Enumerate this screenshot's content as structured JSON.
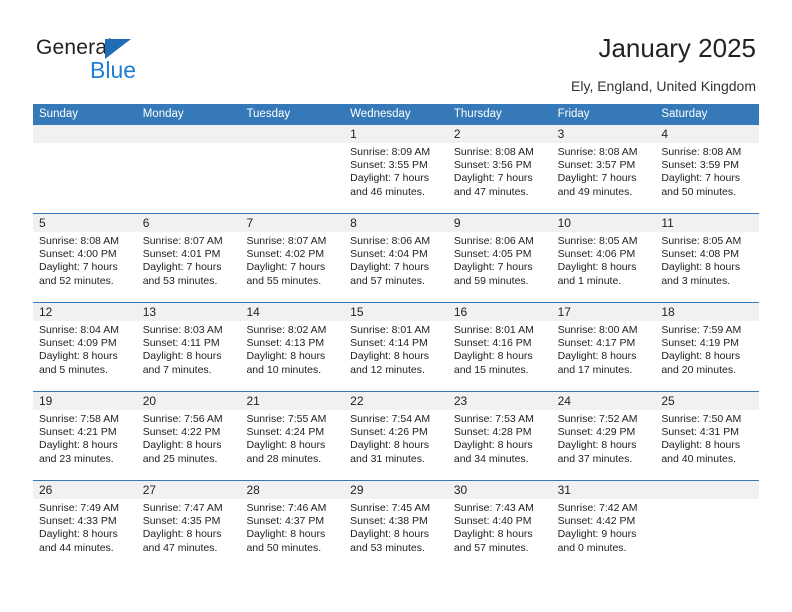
{
  "brand": {
    "name_primary": "General",
    "name_secondary": "Blue",
    "accent_color": "#1f7fd4",
    "triangle_color": "#1f6db4"
  },
  "header": {
    "title": "January 2025",
    "subtitle": "Ely, England, United Kingdom"
  },
  "calendar": {
    "header_bg": "#3579b8",
    "daynum_bg": "#f1f1f1",
    "weekday_labels": [
      "Sunday",
      "Monday",
      "Tuesday",
      "Wednesday",
      "Thursday",
      "Friday",
      "Saturday"
    ],
    "weeks": [
      {
        "days": [
          {
            "num": "",
            "sunrise": "",
            "sunset": "",
            "daylight_line1": "",
            "daylight_line2": "",
            "empty": true
          },
          {
            "num": "",
            "sunrise": "",
            "sunset": "",
            "daylight_line1": "",
            "daylight_line2": "",
            "empty": true
          },
          {
            "num": "",
            "sunrise": "",
            "sunset": "",
            "daylight_line1": "",
            "daylight_line2": "",
            "empty": true
          },
          {
            "num": "1",
            "sunrise": "Sunrise: 8:09 AM",
            "sunset": "Sunset: 3:55 PM",
            "daylight_line1": "Daylight: 7 hours",
            "daylight_line2": "and 46 minutes.",
            "empty": false
          },
          {
            "num": "2",
            "sunrise": "Sunrise: 8:08 AM",
            "sunset": "Sunset: 3:56 PM",
            "daylight_line1": "Daylight: 7 hours",
            "daylight_line2": "and 47 minutes.",
            "empty": false
          },
          {
            "num": "3",
            "sunrise": "Sunrise: 8:08 AM",
            "sunset": "Sunset: 3:57 PM",
            "daylight_line1": "Daylight: 7 hours",
            "daylight_line2": "and 49 minutes.",
            "empty": false
          },
          {
            "num": "4",
            "sunrise": "Sunrise: 8:08 AM",
            "sunset": "Sunset: 3:59 PM",
            "daylight_line1": "Daylight: 7 hours",
            "daylight_line2": "and 50 minutes.",
            "empty": false
          }
        ]
      },
      {
        "days": [
          {
            "num": "5",
            "sunrise": "Sunrise: 8:08 AM",
            "sunset": "Sunset: 4:00 PM",
            "daylight_line1": "Daylight: 7 hours",
            "daylight_line2": "and 52 minutes.",
            "empty": false
          },
          {
            "num": "6",
            "sunrise": "Sunrise: 8:07 AM",
            "sunset": "Sunset: 4:01 PM",
            "daylight_line1": "Daylight: 7 hours",
            "daylight_line2": "and 53 minutes.",
            "empty": false
          },
          {
            "num": "7",
            "sunrise": "Sunrise: 8:07 AM",
            "sunset": "Sunset: 4:02 PM",
            "daylight_line1": "Daylight: 7 hours",
            "daylight_line2": "and 55 minutes.",
            "empty": false
          },
          {
            "num": "8",
            "sunrise": "Sunrise: 8:06 AM",
            "sunset": "Sunset: 4:04 PM",
            "daylight_line1": "Daylight: 7 hours",
            "daylight_line2": "and 57 minutes.",
            "empty": false
          },
          {
            "num": "9",
            "sunrise": "Sunrise: 8:06 AM",
            "sunset": "Sunset: 4:05 PM",
            "daylight_line1": "Daylight: 7 hours",
            "daylight_line2": "and 59 minutes.",
            "empty": false
          },
          {
            "num": "10",
            "sunrise": "Sunrise: 8:05 AM",
            "sunset": "Sunset: 4:06 PM",
            "daylight_line1": "Daylight: 8 hours",
            "daylight_line2": "and 1 minute.",
            "empty": false
          },
          {
            "num": "11",
            "sunrise": "Sunrise: 8:05 AM",
            "sunset": "Sunset: 4:08 PM",
            "daylight_line1": "Daylight: 8 hours",
            "daylight_line2": "and 3 minutes.",
            "empty": false
          }
        ]
      },
      {
        "days": [
          {
            "num": "12",
            "sunrise": "Sunrise: 8:04 AM",
            "sunset": "Sunset: 4:09 PM",
            "daylight_line1": "Daylight: 8 hours",
            "daylight_line2": "and 5 minutes.",
            "empty": false
          },
          {
            "num": "13",
            "sunrise": "Sunrise: 8:03 AM",
            "sunset": "Sunset: 4:11 PM",
            "daylight_line1": "Daylight: 8 hours",
            "daylight_line2": "and 7 minutes.",
            "empty": false
          },
          {
            "num": "14",
            "sunrise": "Sunrise: 8:02 AM",
            "sunset": "Sunset: 4:13 PM",
            "daylight_line1": "Daylight: 8 hours",
            "daylight_line2": "and 10 minutes.",
            "empty": false
          },
          {
            "num": "15",
            "sunrise": "Sunrise: 8:01 AM",
            "sunset": "Sunset: 4:14 PM",
            "daylight_line1": "Daylight: 8 hours",
            "daylight_line2": "and 12 minutes.",
            "empty": false
          },
          {
            "num": "16",
            "sunrise": "Sunrise: 8:01 AM",
            "sunset": "Sunset: 4:16 PM",
            "daylight_line1": "Daylight: 8 hours",
            "daylight_line2": "and 15 minutes.",
            "empty": false
          },
          {
            "num": "17",
            "sunrise": "Sunrise: 8:00 AM",
            "sunset": "Sunset: 4:17 PM",
            "daylight_line1": "Daylight: 8 hours",
            "daylight_line2": "and 17 minutes.",
            "empty": false
          },
          {
            "num": "18",
            "sunrise": "Sunrise: 7:59 AM",
            "sunset": "Sunset: 4:19 PM",
            "daylight_line1": "Daylight: 8 hours",
            "daylight_line2": "and 20 minutes.",
            "empty": false
          }
        ]
      },
      {
        "days": [
          {
            "num": "19",
            "sunrise": "Sunrise: 7:58 AM",
            "sunset": "Sunset: 4:21 PM",
            "daylight_line1": "Daylight: 8 hours",
            "daylight_line2": "and 23 minutes.",
            "empty": false
          },
          {
            "num": "20",
            "sunrise": "Sunrise: 7:56 AM",
            "sunset": "Sunset: 4:22 PM",
            "daylight_line1": "Daylight: 8 hours",
            "daylight_line2": "and 25 minutes.",
            "empty": false
          },
          {
            "num": "21",
            "sunrise": "Sunrise: 7:55 AM",
            "sunset": "Sunset: 4:24 PM",
            "daylight_line1": "Daylight: 8 hours",
            "daylight_line2": "and 28 minutes.",
            "empty": false
          },
          {
            "num": "22",
            "sunrise": "Sunrise: 7:54 AM",
            "sunset": "Sunset: 4:26 PM",
            "daylight_line1": "Daylight: 8 hours",
            "daylight_line2": "and 31 minutes.",
            "empty": false
          },
          {
            "num": "23",
            "sunrise": "Sunrise: 7:53 AM",
            "sunset": "Sunset: 4:28 PM",
            "daylight_line1": "Daylight: 8 hours",
            "daylight_line2": "and 34 minutes.",
            "empty": false
          },
          {
            "num": "24",
            "sunrise": "Sunrise: 7:52 AM",
            "sunset": "Sunset: 4:29 PM",
            "daylight_line1": "Daylight: 8 hours",
            "daylight_line2": "and 37 minutes.",
            "empty": false
          },
          {
            "num": "25",
            "sunrise": "Sunrise: 7:50 AM",
            "sunset": "Sunset: 4:31 PM",
            "daylight_line1": "Daylight: 8 hours",
            "daylight_line2": "and 40 minutes.",
            "empty": false
          }
        ]
      },
      {
        "days": [
          {
            "num": "26",
            "sunrise": "Sunrise: 7:49 AM",
            "sunset": "Sunset: 4:33 PM",
            "daylight_line1": "Daylight: 8 hours",
            "daylight_line2": "and 44 minutes.",
            "empty": false
          },
          {
            "num": "27",
            "sunrise": "Sunrise: 7:47 AM",
            "sunset": "Sunset: 4:35 PM",
            "daylight_line1": "Daylight: 8 hours",
            "daylight_line2": "and 47 minutes.",
            "empty": false
          },
          {
            "num": "28",
            "sunrise": "Sunrise: 7:46 AM",
            "sunset": "Sunset: 4:37 PM",
            "daylight_line1": "Daylight: 8 hours",
            "daylight_line2": "and 50 minutes.",
            "empty": false
          },
          {
            "num": "29",
            "sunrise": "Sunrise: 7:45 AM",
            "sunset": "Sunset: 4:38 PM",
            "daylight_line1": "Daylight: 8 hours",
            "daylight_line2": "and 53 minutes.",
            "empty": false
          },
          {
            "num": "30",
            "sunrise": "Sunrise: 7:43 AM",
            "sunset": "Sunset: 4:40 PM",
            "daylight_line1": "Daylight: 8 hours",
            "daylight_line2": "and 57 minutes.",
            "empty": false
          },
          {
            "num": "31",
            "sunrise": "Sunrise: 7:42 AM",
            "sunset": "Sunset: 4:42 PM",
            "daylight_line1": "Daylight: 9 hours",
            "daylight_line2": "and 0 minutes.",
            "empty": false
          },
          {
            "num": "",
            "sunrise": "",
            "sunset": "",
            "daylight_line1": "",
            "daylight_line2": "",
            "empty": true
          }
        ]
      }
    ]
  }
}
